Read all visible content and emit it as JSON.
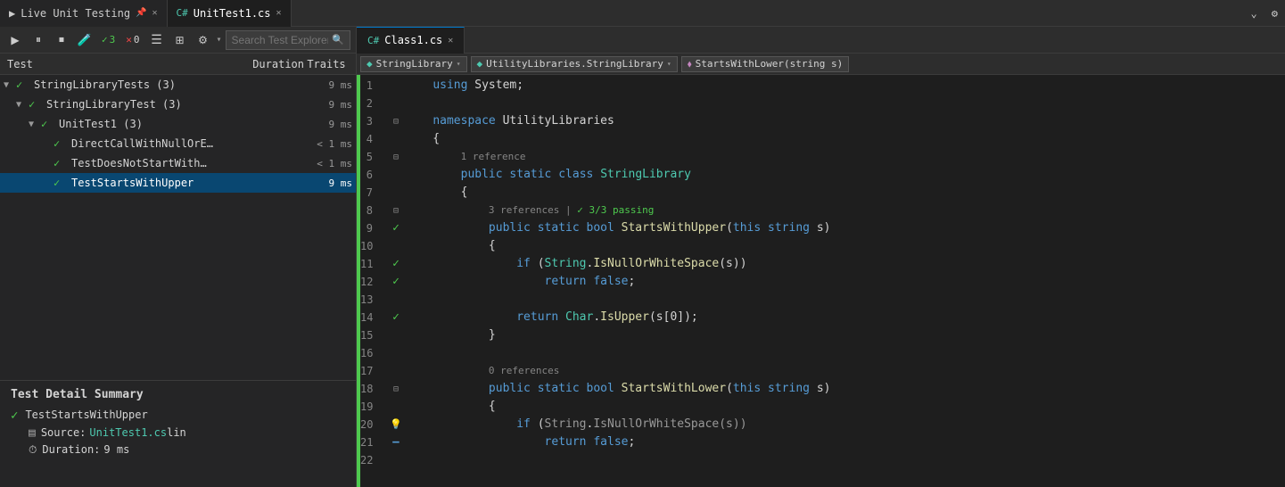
{
  "tabs": {
    "live_testing": {
      "label": "Live Unit Testing",
      "icon": "▶"
    },
    "unittest": {
      "label": "UnitTest1.cs",
      "icon": "C#"
    }
  },
  "toolbar": {
    "search_placeholder": "Search Test Explorer",
    "run_label": "▶",
    "pause_label": "⏸",
    "stop_label": "⏹",
    "flask_label": "🧪",
    "pass_count": "3",
    "fail_label": "✕",
    "fail_count": "0",
    "pass_icon": "✓"
  },
  "columns": {
    "test": "Test",
    "duration": "Duration",
    "traits": "Traits"
  },
  "tree": {
    "items": [
      {
        "indent": 0,
        "expanded": true,
        "name": "StringLibraryTests (3)",
        "duration": "9 ms",
        "status": "pass"
      },
      {
        "indent": 1,
        "expanded": true,
        "name": "StringLibraryTest (3)",
        "duration": "9 ms",
        "status": "pass"
      },
      {
        "indent": 2,
        "expanded": true,
        "name": "UnitTest1 (3)",
        "duration": "9 ms",
        "status": "pass"
      },
      {
        "indent": 3,
        "expanded": false,
        "name": "DirectCallWithNullOrE…",
        "duration": "< 1 ms",
        "status": "pass"
      },
      {
        "indent": 3,
        "expanded": false,
        "name": "TestDoesNotStartWith…",
        "duration": "< 1 ms",
        "status": "pass"
      },
      {
        "indent": 3,
        "expanded": false,
        "name": "TestStartsWithUpper",
        "duration": "9 ms",
        "status": "pass",
        "selected": true
      }
    ]
  },
  "detail": {
    "title": "Test Detail Summary",
    "test_name": "TestStartsWithUpper",
    "source_label": "Source:",
    "source_file": "UnitTest1.cs",
    "source_line": " lin",
    "duration_label": "Duration:",
    "duration_value": "9 ms"
  },
  "editor": {
    "tabs": [
      {
        "label": "Class1.cs",
        "active": true
      },
      {
        "label": "",
        "close": true
      }
    ],
    "nav": {
      "class_label": "StringLibrary",
      "namespace_label": "UtilityLibraries.StringLibrary",
      "method_label": "StartsWithLower(string s)"
    },
    "lines": [
      {
        "num": 1,
        "gutter": "",
        "code": [
          {
            "t": "    ",
            "c": ""
          },
          {
            "t": "using",
            "c": "kw"
          },
          {
            "t": " System;",
            "c": ""
          }
        ]
      },
      {
        "num": 2,
        "gutter": "",
        "code": []
      },
      {
        "num": 3,
        "gutter": "collapse",
        "code": [
          {
            "t": "    ",
            "c": ""
          },
          {
            "t": "namespace",
            "c": "kw"
          },
          {
            "t": " UtilityLibraries",
            "c": ""
          }
        ]
      },
      {
        "num": 4,
        "gutter": "",
        "code": [
          {
            "t": "    {",
            "c": ""
          }
        ]
      },
      {
        "num": 5,
        "gutter": "collapse",
        "code": [
          {
            "t": "        ",
            "c": ""
          },
          {
            "t": "1 reference",
            "c": "ref"
          },
          {
            "t": "",
            "c": ""
          }
        ]
      },
      {
        "num": 6,
        "gutter": "",
        "code": [
          {
            "t": "        ",
            "c": ""
          },
          {
            "t": "public",
            "c": "kw"
          },
          {
            "t": " ",
            "c": ""
          },
          {
            "t": "static",
            "c": "kw"
          },
          {
            "t": " ",
            "c": ""
          },
          {
            "t": "class",
            "c": "kw"
          },
          {
            "t": " ",
            "c": ""
          },
          {
            "t": "StringLibrary",
            "c": "type"
          }
        ]
      },
      {
        "num": 7,
        "gutter": "",
        "code": [
          {
            "t": "        {",
            "c": ""
          }
        ]
      },
      {
        "num": 8,
        "gutter": "collapse",
        "code": [
          {
            "t": "            3 references | ",
            "c": "ref"
          },
          {
            "t": "✓ 3/3 passing",
            "c": "passing"
          }
        ]
      },
      {
        "num": 9,
        "gutter": "check",
        "code": [
          {
            "t": "            ",
            "c": ""
          },
          {
            "t": "public",
            "c": "kw"
          },
          {
            "t": " ",
            "c": ""
          },
          {
            "t": "static",
            "c": "kw"
          },
          {
            "t": " ",
            "c": ""
          },
          {
            "t": "bool",
            "c": "kw"
          },
          {
            "t": " ",
            "c": ""
          },
          {
            "t": "StartsWithUpper",
            "c": "fn"
          },
          {
            "t": "(",
            "c": ""
          },
          {
            "t": "this",
            "c": "kw"
          },
          {
            "t": " ",
            "c": ""
          },
          {
            "t": "string",
            "c": "kw"
          },
          {
            "t": " s)",
            "c": ""
          }
        ]
      },
      {
        "num": 10,
        "gutter": "",
        "code": [
          {
            "t": "            {",
            "c": ""
          }
        ]
      },
      {
        "num": 11,
        "gutter": "check",
        "code": [
          {
            "t": "                ",
            "c": ""
          },
          {
            "t": "if",
            "c": "kw"
          },
          {
            "t": " (",
            "c": ""
          },
          {
            "t": "String",
            "c": "type"
          },
          {
            "t": ".",
            "c": ""
          },
          {
            "t": "IsNullOrWhiteSpace",
            "c": "fn"
          },
          {
            "t": "(s))",
            "c": ""
          }
        ]
      },
      {
        "num": 12,
        "gutter": "check",
        "code": [
          {
            "t": "                    ",
            "c": ""
          },
          {
            "t": "return",
            "c": "kw"
          },
          {
            "t": " ",
            "c": ""
          },
          {
            "t": "false",
            "c": "kw"
          },
          {
            "t": ";",
            "c": ""
          }
        ]
      },
      {
        "num": 13,
        "gutter": "",
        "code": []
      },
      {
        "num": 14,
        "gutter": "check",
        "code": [
          {
            "t": "                ",
            "c": ""
          },
          {
            "t": "return",
            "c": "kw"
          },
          {
            "t": " ",
            "c": ""
          },
          {
            "t": "Char",
            "c": "type"
          },
          {
            "t": ".",
            "c": ""
          },
          {
            "t": "IsUpper",
            "c": "fn"
          },
          {
            "t": "(s[0]);",
            "c": ""
          }
        ]
      },
      {
        "num": 15,
        "gutter": "",
        "code": [
          {
            "t": "            }",
            "c": ""
          }
        ]
      },
      {
        "num": 16,
        "gutter": "",
        "code": []
      },
      {
        "num": 17,
        "gutter": "",
        "code": [
          {
            "t": "            0 references",
            "c": "ref"
          }
        ]
      },
      {
        "num": 18,
        "gutter": "collapse",
        "code": [
          {
            "t": "            ",
            "c": ""
          },
          {
            "t": "public",
            "c": "kw"
          },
          {
            "t": " ",
            "c": ""
          },
          {
            "t": "static",
            "c": "kw"
          },
          {
            "t": " ",
            "c": ""
          },
          {
            "t": "bool",
            "c": "kw"
          },
          {
            "t": " ",
            "c": ""
          },
          {
            "t": "StartsWithLower",
            "c": "fn"
          },
          {
            "t": "(",
            "c": ""
          },
          {
            "t": "this",
            "c": "kw"
          },
          {
            "t": " ",
            "c": ""
          },
          {
            "t": "string",
            "c": "kw"
          },
          {
            "t": " s)",
            "c": ""
          }
        ]
      },
      {
        "num": 19,
        "gutter": "",
        "code": [
          {
            "t": "            {",
            "c": ""
          }
        ]
      },
      {
        "num": 20,
        "gutter": "bulb",
        "code": [
          {
            "t": "                ",
            "c": ""
          },
          {
            "t": "if",
            "c": "kw"
          },
          {
            "t": " (",
            "c": ""
          },
          {
            "t": "String",
            "c": "type"
          },
          {
            "t": ".",
            "c": ""
          },
          {
            "t": "IsNullOrWhiteSpace",
            "c": "fn"
          },
          {
            "t": "(s))",
            "c": ""
          }
        ]
      },
      {
        "num": 21,
        "gutter": "minus",
        "code": [
          {
            "t": "                    ",
            "c": ""
          },
          {
            "t": "return",
            "c": "kw"
          },
          {
            "t": " ",
            "c": ""
          },
          {
            "t": "false",
            "c": "kw"
          },
          {
            "t": ";",
            "c": ""
          }
        ]
      },
      {
        "num": 22,
        "gutter": "",
        "code": []
      }
    ]
  },
  "colors": {
    "accent_blue": "#007acc",
    "green": "#4ec94e",
    "selected_bg": "#094771"
  }
}
